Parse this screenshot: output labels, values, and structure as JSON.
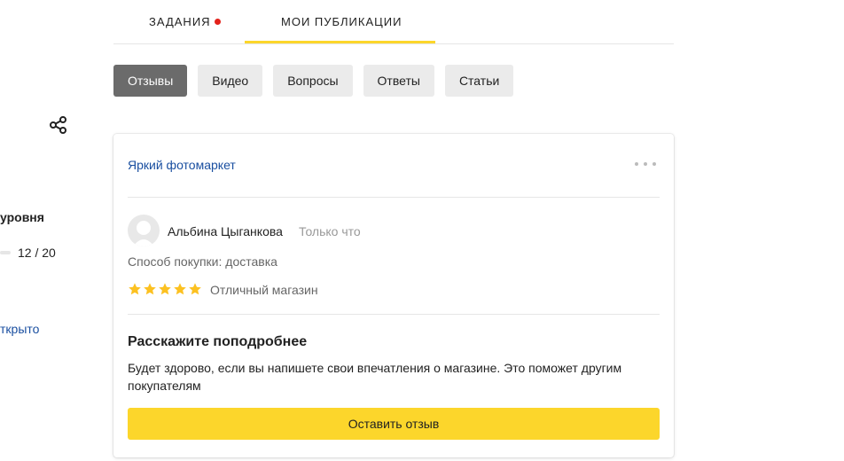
{
  "sidebar": {
    "share_icon": "share-icon",
    "level_label": "уровня",
    "progress_text": "12 / 20",
    "progress_value": 0.6,
    "open_link": "ткрыто"
  },
  "tabs": [
    {
      "label": "ЗАДАНИЯ",
      "has_dot": true
    },
    {
      "label": "МОИ ПУБЛИКАЦИИ",
      "active": true
    }
  ],
  "filters": [
    {
      "label": "Отзывы",
      "active": true
    },
    {
      "label": "Видео"
    },
    {
      "label": "Вопросы"
    },
    {
      "label": "Ответы"
    },
    {
      "label": "Статьи"
    }
  ],
  "card": {
    "shop_name": "Яркий фотомаркет",
    "more_icon": "more-dots-icon",
    "author": "Альбина Цыганкова",
    "time": "Только что",
    "purchase_method": "Способ покупки: доставка",
    "rating": 5,
    "rating_text": "Отличный магазин",
    "tell_title": "Расскажите поподробнее",
    "tell_desc": "Будет здорово, если вы напишете свои впечатления о магазине. Это поможет другим покупателям",
    "button_label": "Оставить отзыв"
  },
  "colors": {
    "accent_yellow": "#fcd62b",
    "link_blue": "#1a4fa0",
    "notification_red": "#e3221b",
    "active_pill": "#6b6b6b",
    "star": "#fcc121"
  }
}
